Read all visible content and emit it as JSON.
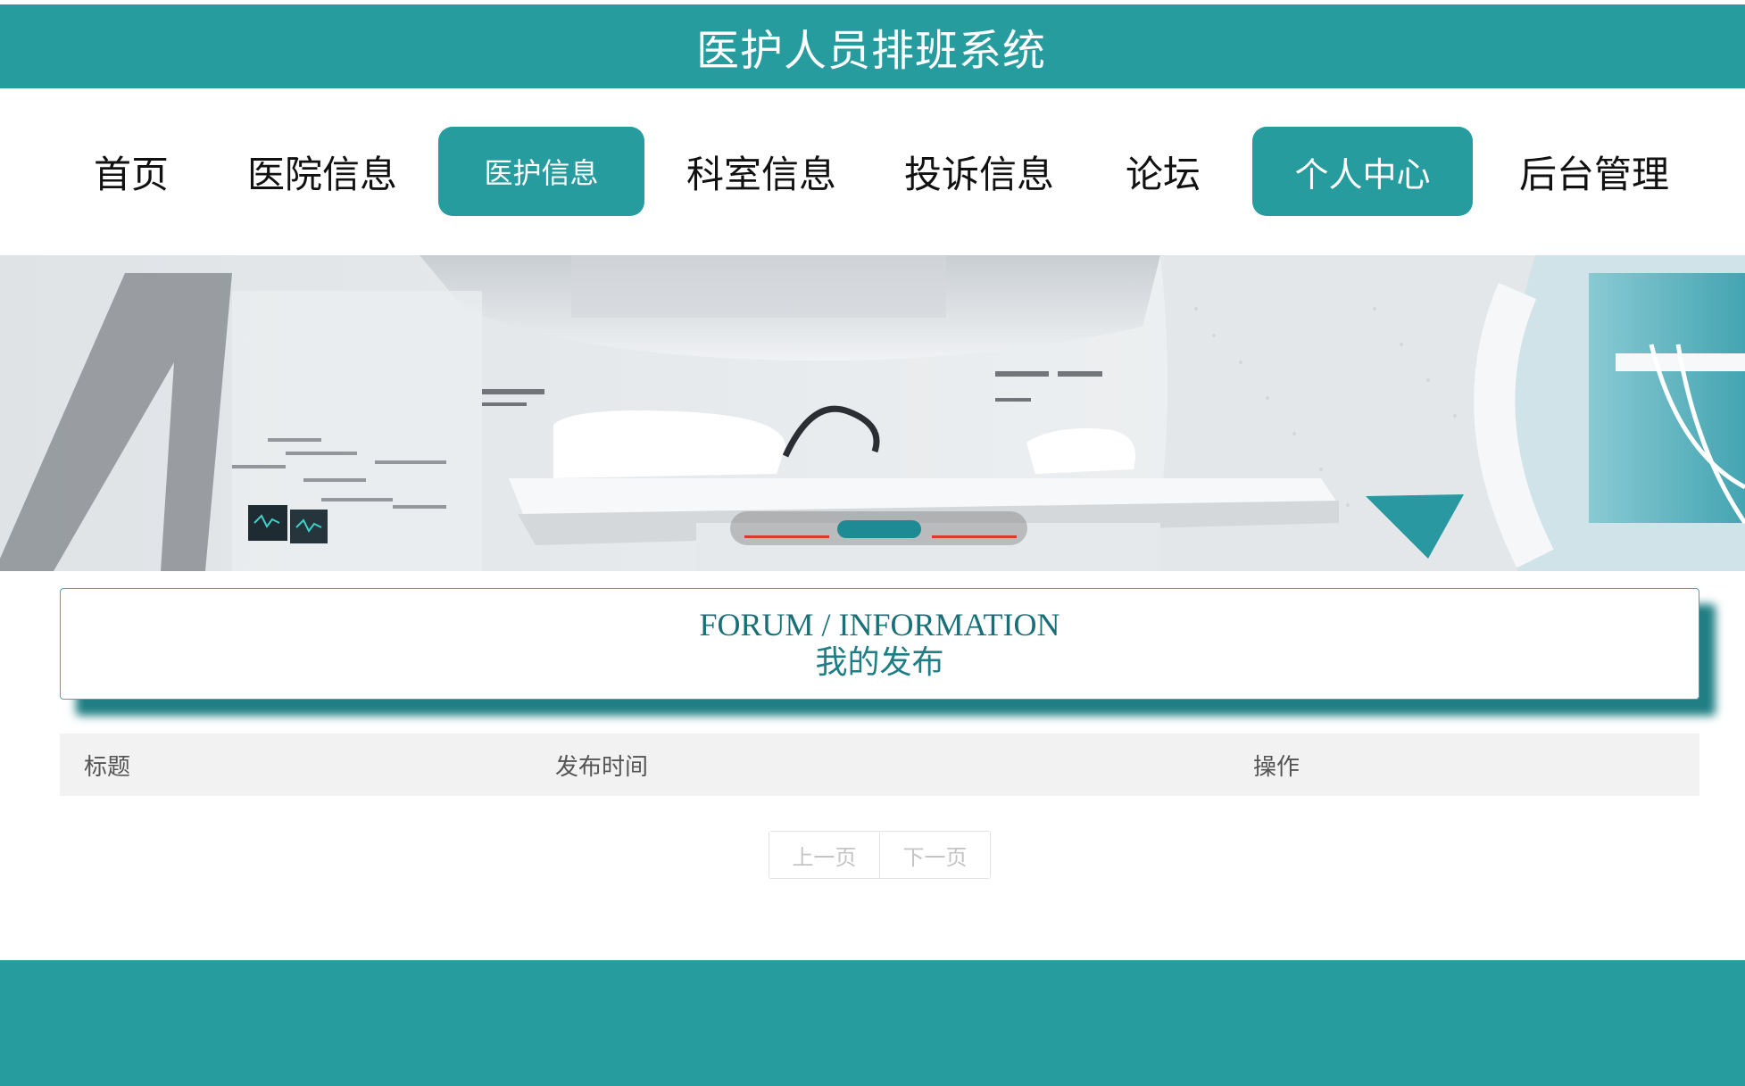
{
  "header": {
    "title": "医护人员排班系统"
  },
  "nav": {
    "items": [
      {
        "label": "首页"
      },
      {
        "label": "医院信息"
      },
      {
        "label": "医护信息"
      },
      {
        "label": "科室信息"
      },
      {
        "label": "投诉信息"
      },
      {
        "label": "论坛"
      },
      {
        "label": "个人中心"
      },
      {
        "label": "后台管理"
      }
    ],
    "active_items": [
      "医护信息",
      "个人中心"
    ]
  },
  "banner": {
    "slide_count": 3,
    "active_slide": 2
  },
  "section": {
    "title_en": "FORUM / INFORMATION",
    "title_cn": "我的发布"
  },
  "table": {
    "columns": [
      "标题",
      "发布时间",
      "操作"
    ],
    "rows": []
  },
  "pagination": {
    "prev_label": "上一页",
    "next_label": "下一页"
  },
  "colors": {
    "brand": "#279c9f",
    "brand_dark": "#186f78",
    "indicator_active": "#1e8a94",
    "indicator_line": "#d93a2a"
  }
}
